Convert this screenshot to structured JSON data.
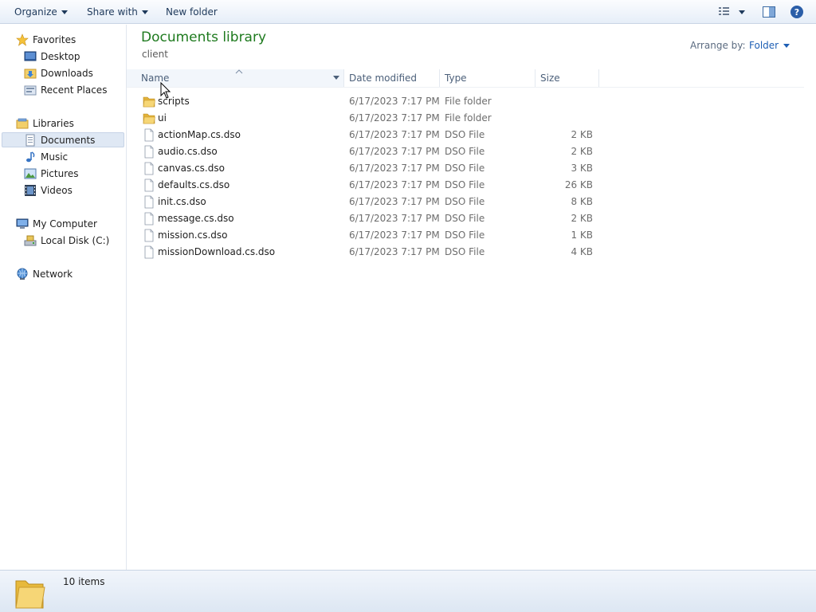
{
  "toolbar": {
    "organize_label": "Organize",
    "share_label": "Share with",
    "new_folder_label": "New folder"
  },
  "nav": {
    "favorites": "Favorites",
    "desktop": "Desktop",
    "downloads": "Downloads",
    "recent_places": "Recent Places",
    "libraries": "Libraries",
    "documents": "Documents",
    "music": "Music",
    "pictures": "Pictures",
    "videos": "Videos",
    "my_computer": "My Computer",
    "local_disk": "Local Disk (C:)",
    "network": "Network"
  },
  "library": {
    "title": "Documents library",
    "subtitle": "client",
    "arrange_by_label": "Arrange by:",
    "arrange_by_value": "Folder"
  },
  "columns": {
    "name": "Name",
    "date_modified": "Date modified",
    "type": "Type",
    "size": "Size"
  },
  "files": [
    {
      "name": "scripts",
      "date": "6/17/2023 7:17 PM",
      "type": "File folder",
      "size": "",
      "icon": "folder-icon"
    },
    {
      "name": "ui",
      "date": "6/17/2023 7:17 PM",
      "type": "File folder",
      "size": "",
      "icon": "folder-icon"
    },
    {
      "name": "actionMap.cs.dso",
      "date": "6/17/2023 7:17 PM",
      "type": "DSO File",
      "size": "2 KB",
      "icon": "file-icon"
    },
    {
      "name": "audio.cs.dso",
      "date": "6/17/2023 7:17 PM",
      "type": "DSO File",
      "size": "2 KB",
      "icon": "file-icon"
    },
    {
      "name": "canvas.cs.dso",
      "date": "6/17/2023 7:17 PM",
      "type": "DSO File",
      "size": "3 KB",
      "icon": "file-icon"
    },
    {
      "name": "defaults.cs.dso",
      "date": "6/17/2023 7:17 PM",
      "type": "DSO File",
      "size": "26 KB",
      "icon": "file-icon"
    },
    {
      "name": "init.cs.dso",
      "date": "6/17/2023 7:17 PM",
      "type": "DSO File",
      "size": "8 KB",
      "icon": "file-icon"
    },
    {
      "name": "message.cs.dso",
      "date": "6/17/2023 7:17 PM",
      "type": "DSO File",
      "size": "2 KB",
      "icon": "file-icon"
    },
    {
      "name": "mission.cs.dso",
      "date": "6/17/2023 7:17 PM",
      "type": "DSO File",
      "size": "1 KB",
      "icon": "file-icon"
    },
    {
      "name": "missionDownload.cs.dso",
      "date": "6/17/2023 7:17 PM",
      "type": "DSO File",
      "size": "4 KB",
      "icon": "file-icon"
    }
  ],
  "status": {
    "item_count": "10 items"
  },
  "colors": {
    "title_green": "#1e7a1e",
    "link_blue": "#1e5fb4",
    "selection": "#dfe8f4"
  }
}
